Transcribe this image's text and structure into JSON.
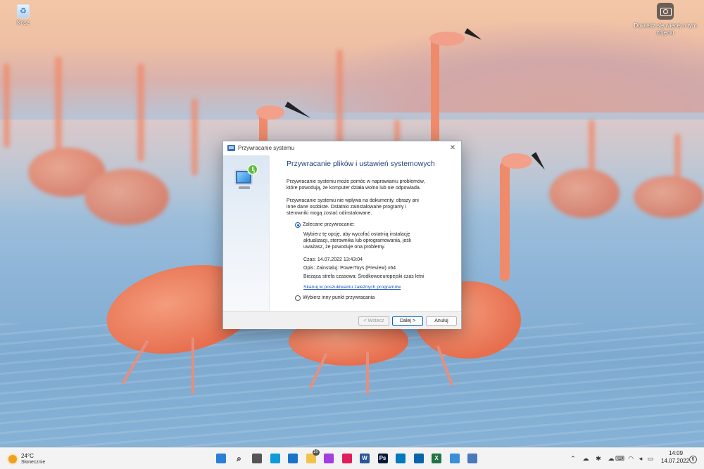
{
  "desktop": {
    "recycle_bin_label": "Kosz",
    "spotlight_label": "Dowiedz się więcej o tym zdjęciu"
  },
  "dialog": {
    "title": "Przywracanie systemu",
    "heading": "Przywracanie plików i ustawień systemowych",
    "para1": "Przywracanie systemu może pomóc w naprawianiu problemów, które powodują, że komputer działa wolno lub nie odpowiada.",
    "para2": "Przywracanie systemu nie wpływa na dokumenty, obrazy ani inne dane osobiste. Ostatnio zainstalowane programy i sterowniki mogą zostać odinstalowane.",
    "option_recommended": "Zalecane przywracanie:",
    "option_recommended_desc": "Wybierz tę opcję, aby wycofać ostatnią instalację aktualizacji, sterownika lub oprogramowania, jeśli uważasz, że powoduje ona problemy.",
    "time": "Czas: 14.07.2022 13:43:04",
    "description": "Opis: Zainstaluj: PowerToys (Preview) x64",
    "timezone": "Bieżąca strefa czasowa: Środkowoeuropejski czas letni",
    "scan_link": "Skanuj w poszukiwaniu zależnych programów",
    "option_other": "Wybierz inny punkt przywracania",
    "btn_back": "< Wstecz",
    "btn_next": "Dalej >",
    "btn_cancel": "Anuluj",
    "selected_option": "recommended"
  },
  "taskbar": {
    "weather_temp": "24°C",
    "weather_condition": "Słonecznie",
    "apps": [
      {
        "name": "start",
        "icon": "windows-logo-icon",
        "color": "#2a7fd6"
      },
      {
        "name": "search",
        "icon": "search-icon",
        "color": "#333333"
      },
      {
        "name": "task-view",
        "icon": "task-view-icon",
        "color": "#555555"
      },
      {
        "name": "edge",
        "icon": "edge-icon",
        "color": "#0f9bd7"
      },
      {
        "name": "mail",
        "icon": "mail-icon",
        "color": "#1a73c8"
      },
      {
        "name": "explorer",
        "icon": "folder-icon",
        "color": "#f2c24a",
        "badge": "10"
      },
      {
        "name": "messenger",
        "icon": "messenger-icon",
        "color": "#a33fe0"
      },
      {
        "name": "slack",
        "icon": "slack-icon",
        "color": "#e01e5a"
      },
      {
        "name": "word",
        "icon": "word-icon",
        "color": "#2b579a",
        "text": "W"
      },
      {
        "name": "photoshop",
        "icon": "photoshop-icon",
        "color": "#0a1a3a",
        "text": "Ps"
      },
      {
        "name": "trello",
        "icon": "trello-icon",
        "color": "#0079bf"
      },
      {
        "name": "outlook",
        "icon": "outlook-icon",
        "color": "#0a64ad"
      },
      {
        "name": "excel",
        "icon": "excel-icon",
        "color": "#217346",
        "text": "X"
      },
      {
        "name": "snip",
        "icon": "snipping-tool-icon",
        "color": "#3a8fd6"
      },
      {
        "name": "restore",
        "icon": "system-restore-icon",
        "color": "#4a7ab8"
      }
    ],
    "time": "14:09",
    "date": "14.07.2022",
    "notifications": "6"
  }
}
